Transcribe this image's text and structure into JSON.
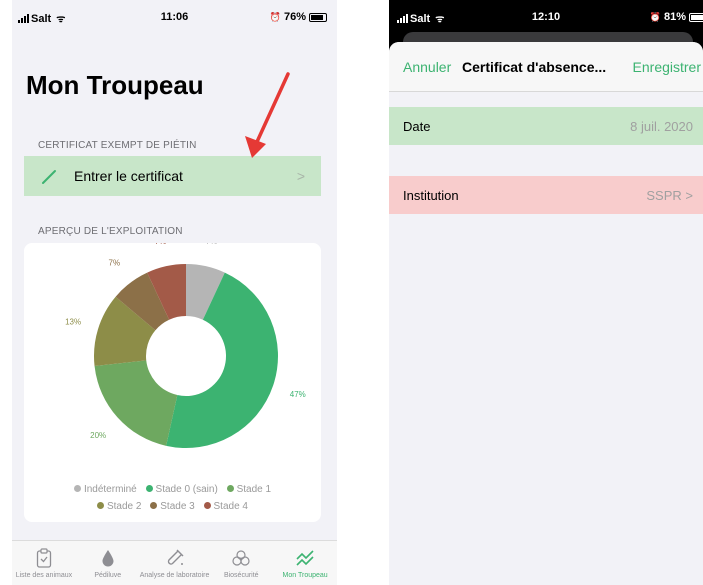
{
  "phone1": {
    "status": {
      "carrier": "Salt",
      "time": "11:06",
      "battery": "76%",
      "battery_level": 0.76
    },
    "title": "Mon Troupeau",
    "cert_section": {
      "header": "CERTIFICAT EXEMPT DE PIÉTIN",
      "row_label": "Entrer le certificat",
      "pencil_icon": "pencil-icon",
      "chevron": ">"
    },
    "overview_section": {
      "header": "APERÇU DE L'EXPLOITATION"
    },
    "chart_data": {
      "type": "pie",
      "title": "",
      "slices": [
        {
          "name": "Indéterminé",
          "value": 7,
          "label": "7%",
          "color": "#b5b5b5"
        },
        {
          "name": "Stade 0 (sain)",
          "value": 47,
          "label": "47%",
          "color": "#3cb371"
        },
        {
          "name": "Stade 1",
          "value": 20,
          "label": "20%",
          "color": "#6ea860"
        },
        {
          "name": "Stade 2",
          "value": 13,
          "label": "13%",
          "color": "#8d8d48"
        },
        {
          "name": "Stade 3",
          "value": 7,
          "label": "7%",
          "color": "#8c7048"
        },
        {
          "name": "Stade 4",
          "value": 7,
          "label": "7%",
          "color": "#a35a48"
        }
      ],
      "legend_rows": [
        [
          "Indéterminé",
          "Stade 0 (sain)",
          "Stade 1"
        ],
        [
          "Stade 2",
          "Stade 3",
          "Stade 4"
        ]
      ]
    },
    "tabs": [
      {
        "label": "Liste des animaux",
        "icon": "clipboard-check-icon",
        "active": false
      },
      {
        "label": "Pédiluve",
        "icon": "drop-icon",
        "active": false
      },
      {
        "label": "Analyse de laboratoire",
        "icon": "test-tube-icon",
        "active": false
      },
      {
        "label": "Biosécurité",
        "icon": "biohazard-icon",
        "active": false
      },
      {
        "label": "Mon Troupeau",
        "icon": "trend-chart-icon",
        "active": true
      }
    ]
  },
  "phone2": {
    "status": {
      "carrier": "Salt",
      "time": "12:10",
      "battery": "81%",
      "battery_level": 0.81
    },
    "nav": {
      "cancel": "Annuler",
      "title": "Certificat d'absence...",
      "save": "Enregistrer"
    },
    "date": {
      "label": "Date",
      "value": "8 juil. 2020"
    },
    "institution": {
      "label": "Institution",
      "value": "SSPR",
      "chevron": ">"
    }
  },
  "colors": {
    "accent": "#3cb371",
    "valid_row": "#c8e6c9",
    "invalid_row": "#f8cccc",
    "annotation_arrow": "#e53935"
  }
}
